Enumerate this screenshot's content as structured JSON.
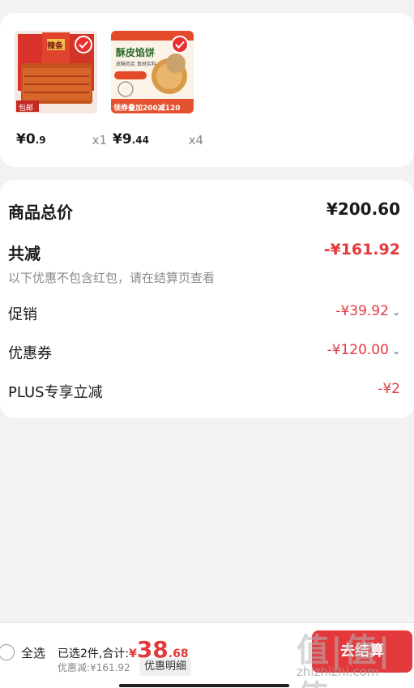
{
  "products": [
    {
      "image_text_top": "辣条",
      "image_badge": "包邮",
      "price_int": "¥0",
      "price_dec": ".9",
      "qty": "x1"
    },
    {
      "image_title": "酥皮馅饼",
      "image_sub": "皮酥肉足 真材实料",
      "image_banner": "领券叠加200减120",
      "price_int": "¥9",
      "price_dec": ".44",
      "qty": "x4"
    }
  ],
  "summary": {
    "total_label": "商品总价",
    "total_value": "¥200.60",
    "discount_label": "共减",
    "discount_value": "-¥161.92",
    "note": "以下优惠不包含红包，请在结算页查看",
    "promo_label": "促销",
    "promo_value": "-¥39.92",
    "coupon_label": "优惠券",
    "coupon_value": "-¥120.00",
    "plus_label": "PLUS专享立减",
    "plus_value": "-¥2"
  },
  "bottom": {
    "select_all": "全选",
    "selected_text": "已选2件,合计:",
    "currency": "¥",
    "total_int": "38",
    "total_dec": ".68",
    "discount_text": "优惠减:¥161.92",
    "detail_button": "优惠明细",
    "checkout_button": "去结算"
  },
  "watermark": {
    "logo": "值|值|值",
    "url": "zhizhizhi.com"
  },
  "colors": {
    "accent": "#e4393c",
    "background": "#f2f2f2"
  }
}
